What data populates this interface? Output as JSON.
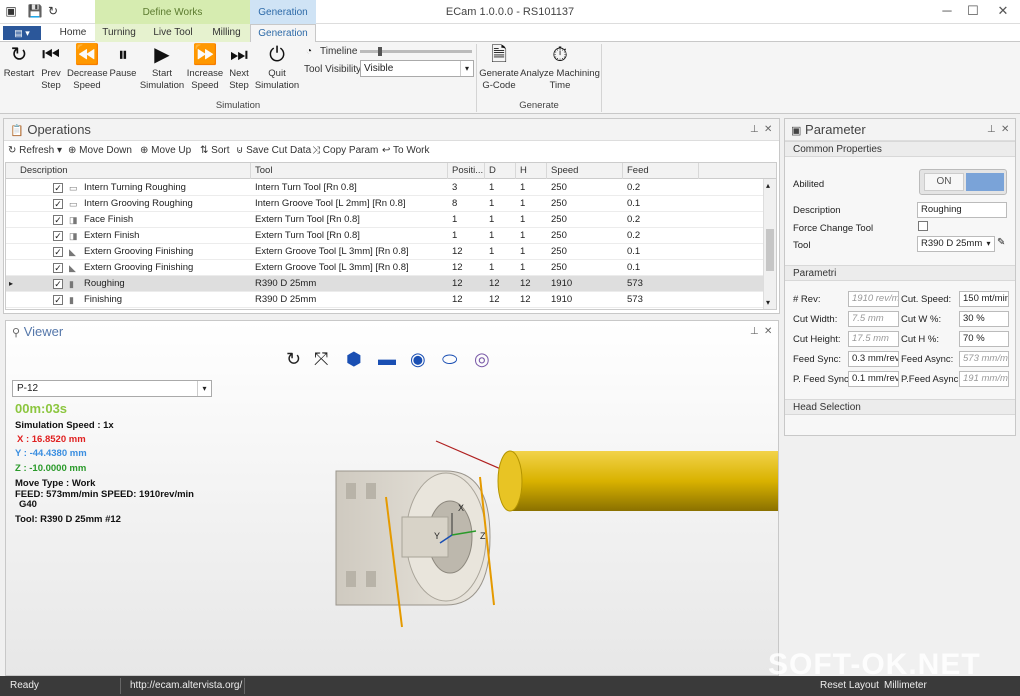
{
  "window": {
    "title": "ECam 1.0.0.0 - RS101137",
    "minimize": "─",
    "maximize": "☐",
    "close": "✕"
  },
  "context_tabs": {
    "define_works": "Define Works",
    "generation": "Generation"
  },
  "tabs": [
    {
      "label": "Home"
    },
    {
      "label": "Turning"
    },
    {
      "label": "Live Tool"
    },
    {
      "label": "Milling"
    },
    {
      "label": "Generation"
    }
  ],
  "ribbon": {
    "simulation": {
      "restart": "Restart",
      "prev_step": "Prev Step",
      "decrease_speed": "Decrease Speed",
      "pause": "Pause",
      "start_simulation": "Start Simulation",
      "increase_speed": "Increase Speed",
      "next_step": "Next Step",
      "quit_simulation": "Quit Simulation",
      "timeline_label": "Timeline",
      "tool_visibility_label": "Tool Visibility",
      "tool_visibility_value": "Visible",
      "group_label": "Simulation"
    },
    "generate": {
      "generate_gcode": "Generate G-Code",
      "analyze_time": "Analyze Machining Time",
      "group_label": "Generate"
    }
  },
  "operations": {
    "title": "Operations",
    "toolbar": {
      "refresh": "Refresh",
      "move_down": "Move Down",
      "move_up": "Move Up",
      "sort": "Sort",
      "save_cut_data": "Save Cut Data",
      "copy_param": "Copy Param",
      "to_work": "To Work"
    },
    "columns": [
      "Description",
      "Tool",
      "Positi...",
      "D",
      "H",
      "Speed",
      "Feed"
    ],
    "rows": [
      {
        "description": "Intern Turning Roughing",
        "tool": "Intern Turn Tool  [Rn 0.8]",
        "position": "3",
        "d": "1",
        "h": "1",
        "speed": "250",
        "feed": "0.2"
      },
      {
        "description": "Intern Grooving Roughing",
        "tool": "Intern Groove Tool [L 2mm] [Rn 0.8]",
        "position": "8",
        "d": "1",
        "h": "1",
        "speed": "250",
        "feed": "0.1"
      },
      {
        "description": "Face Finish",
        "tool": "Extern Turn Tool  [Rn 0.8]",
        "position": "1",
        "d": "1",
        "h": "1",
        "speed": "250",
        "feed": "0.2"
      },
      {
        "description": "Extern Finish",
        "tool": "Extern Turn Tool  [Rn 0.8]",
        "position": "1",
        "d": "1",
        "h": "1",
        "speed": "250",
        "feed": "0.2"
      },
      {
        "description": "Extern Grooving Finishing",
        "tool": "Extern Groove Tool [L 3mm] [Rn 0.8]",
        "position": "12",
        "d": "1",
        "h": "1",
        "speed": "250",
        "feed": "0.1"
      },
      {
        "description": "Extern Grooving Finishing",
        "tool": "Extern Groove Tool [L 3mm] [Rn 0.8]",
        "position": "12",
        "d": "1",
        "h": "1",
        "speed": "250",
        "feed": "0.1"
      },
      {
        "description": "Roughing",
        "tool": "R390 D 25mm",
        "position": "12",
        "d": "12",
        "h": "12",
        "speed": "1910",
        "feed": "573"
      },
      {
        "description": "Finishing",
        "tool": "R390 D 25mm",
        "position": "12",
        "d": "12",
        "h": "12",
        "speed": "1910",
        "feed": "573"
      }
    ]
  },
  "viewer": {
    "title": "Viewer",
    "program": "P-12",
    "time": "00m:03s",
    "sim_speed": "Simulation Speed : 1x",
    "x": "X : 16.8520 mm",
    "y": "Y : -44.4380 mm",
    "z": "Z : -10.0000 mm",
    "move_type": "Move Type : Work",
    "feed_speed": "FEED: 573mm/min SPEED: 1910rev/min",
    "g40": "G40",
    "tool": "Tool: R390 D 25mm  #12",
    "axis_x": "X",
    "axis_y": "Y",
    "axis_z": "Z",
    "colors": {
      "x": "#e02020",
      "y": "#3a8ee0",
      "z": "#2a9a2a",
      "time": "#8cc63f"
    }
  },
  "parameter": {
    "title": "Parameter",
    "common_header": "Common Properties",
    "abilited_label": "Abilited",
    "toggle_label": "ON",
    "description_label": "Description",
    "description_value": "Roughing",
    "force_change_label": "Force Change Tool",
    "tool_label": "Tool",
    "tool_value": "R390 D 25mm",
    "parametri_header": "Parametri",
    "rev_label": "# Rev:",
    "rev_value": "1910 rev/m",
    "cut_speed_label": "Cut. Speed:",
    "cut_speed_value": "150 mt/min",
    "cut_width_label": "Cut Width:",
    "cut_width_value": "7.5 mm",
    "cut_w_label": "Cut W %:",
    "cut_w_value": "30 %",
    "cut_height_label": "Cut Height:",
    "cut_height_value": "17.5 mm",
    "cut_h_label": "Cut H %:",
    "cut_h_value": "70 %",
    "feed_sync_label": "Feed Sync:",
    "feed_sync_value": "0.3 mm/rev",
    "feed_async_label": "Feed Async:",
    "feed_async_value": "573 mm/m",
    "pfeed_sync_label": "P. Feed Sync:",
    "pfeed_sync_value": "0.1 mm/rev",
    "pfeed_async_label": "P.Feed Async:",
    "pfeed_async_value": "191 mm/m",
    "head_selection": "Head Selection"
  },
  "statusbar": {
    "status": "Ready",
    "url": "http://ecam.altervista.org/",
    "reset_layout": "Reset Layout",
    "unit": "Millimeter"
  },
  "watermark": "SOFT-OK.NET"
}
